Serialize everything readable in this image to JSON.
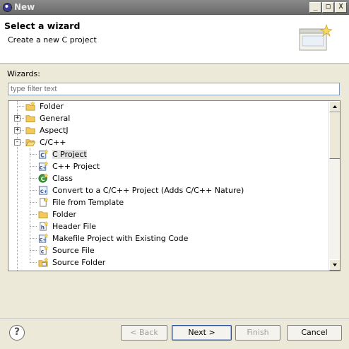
{
  "window": {
    "title": "New",
    "controls": {
      "minimize": "_",
      "maximize": "□",
      "close": "X"
    }
  },
  "banner": {
    "title": "Select a wizard",
    "subtitle": "Create a new C project"
  },
  "wizards_label": "Wizards:",
  "filter": {
    "placeholder": "type filter text",
    "value": ""
  },
  "tree": {
    "items": [
      {
        "label": "Folder",
        "icon": "folder-new-icon",
        "level": 0,
        "expander": ""
      },
      {
        "label": "General",
        "icon": "folder-icon",
        "level": 0,
        "expander": "+"
      },
      {
        "label": "AspectJ",
        "icon": "folder-icon",
        "level": 0,
        "expander": "+"
      },
      {
        "label": "C/C++",
        "icon": "folder-open-icon",
        "level": 0,
        "expander": "-"
      },
      {
        "label": "C Project",
        "icon": "c-project-icon",
        "level": 1,
        "selected": true
      },
      {
        "label": "C++ Project",
        "icon": "cpp-project-icon",
        "level": 1
      },
      {
        "label": "Class",
        "icon": "class-icon",
        "level": 1
      },
      {
        "label": "Convert to a C/C++ Project (Adds C/C++ Nature)",
        "icon": "convert-icon",
        "level": 1
      },
      {
        "label": "File from Template",
        "icon": "file-icon",
        "level": 1
      },
      {
        "label": "Folder",
        "icon": "folder-icon",
        "level": 1
      },
      {
        "label": "Header File",
        "icon": "header-file-icon",
        "level": 1
      },
      {
        "label": "Makefile Project with Existing Code",
        "icon": "makefile-project-icon",
        "level": 1
      },
      {
        "label": "Source File",
        "icon": "source-file-icon",
        "level": 1
      },
      {
        "label": "Source Folder",
        "icon": "source-folder-icon",
        "level": 1
      }
    ]
  },
  "buttons": {
    "help": "?",
    "back": "< Back",
    "next": "Next >",
    "finish": "Finish",
    "cancel": "Cancel"
  },
  "colors": {
    "dialog_bg": "#ece9d8",
    "titlebar": "#6a6a6a",
    "accent_border": "#2a4f9a"
  }
}
